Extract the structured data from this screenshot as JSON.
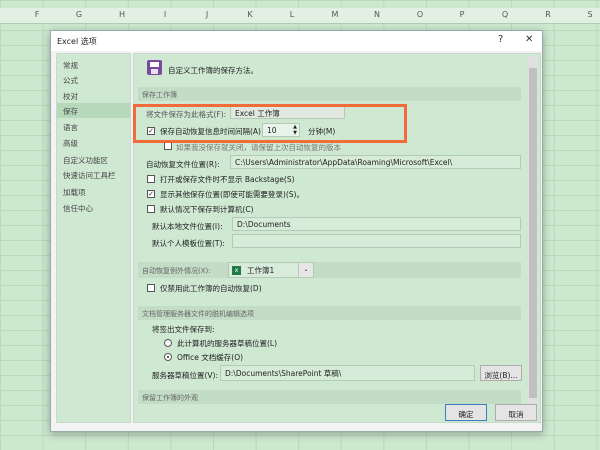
{
  "sheet": {
    "columns": [
      "F",
      "G",
      "H",
      "I",
      "J",
      "K",
      "L",
      "M",
      "N",
      "O",
      "P",
      "Q",
      "R",
      "S"
    ]
  },
  "dialog": {
    "title": "Excel 选项",
    "help": "?",
    "close": "✕"
  },
  "sidebar": {
    "items": [
      "常规",
      "公式",
      "校对",
      "保存",
      "语言",
      "高级",
      "自定义功能区",
      "快速访问工具栏",
      "加载项",
      "信任中心"
    ],
    "selected": "保存"
  },
  "content": {
    "heading": "自定义工作簿的保存方法。",
    "section_save": "保存工作簿",
    "format_label": "将文件保存为此格式(F):",
    "format_value": "Excel 工作簿",
    "autorecover_label": "保存自动恢复信息时间间隔(A)",
    "autorecover_minutes": "10",
    "minutes_label": "分钟(M)",
    "keep_last_label": "如果我没保存就关闭，请保留上次自动恢复的版本",
    "autorecover_location_label": "自动恢复文件位置(R):",
    "autorecover_location": "C:\\Users\\Administrator\\AppData\\Roaming\\Microsoft\\Excel\\",
    "backstage_label": "打开或保存文件时不显示 Backstage(S)",
    "show_other_label": "显示其他保存位置(即使可能需要登录)(S)。",
    "save_computer_label": "默认情况下保存到计算机(C)",
    "default_local_label": "默认本地文件位置(I):",
    "default_local": "D:\\Documents",
    "template_label": "默认个人模板位置(T):",
    "template_value": "",
    "section_exceptions": "自动恢复例外情况(X):",
    "workbook_value": "工作簿1",
    "disable_label": "仅禁用此工作簿的自动恢复(D)",
    "section_offline": "文档管理服务器文件的脱机编辑选项",
    "checkout_label": "将签出文件保存到:",
    "radio_server": "此计算机的服务器草稿位置(L)",
    "radio_office": "Office 文档缓存(O)",
    "drafts_label": "服务器草稿位置(V):",
    "drafts_value": "D:\\Documents\\SharePoint 草稿\\",
    "browse": "浏览(B)...",
    "section_appearance": "保留工作簿的外观"
  },
  "footer": {
    "ok": "确定",
    "cancel": "取消"
  },
  "checks": {
    "autorecover": "✓",
    "show_other": "✓"
  }
}
